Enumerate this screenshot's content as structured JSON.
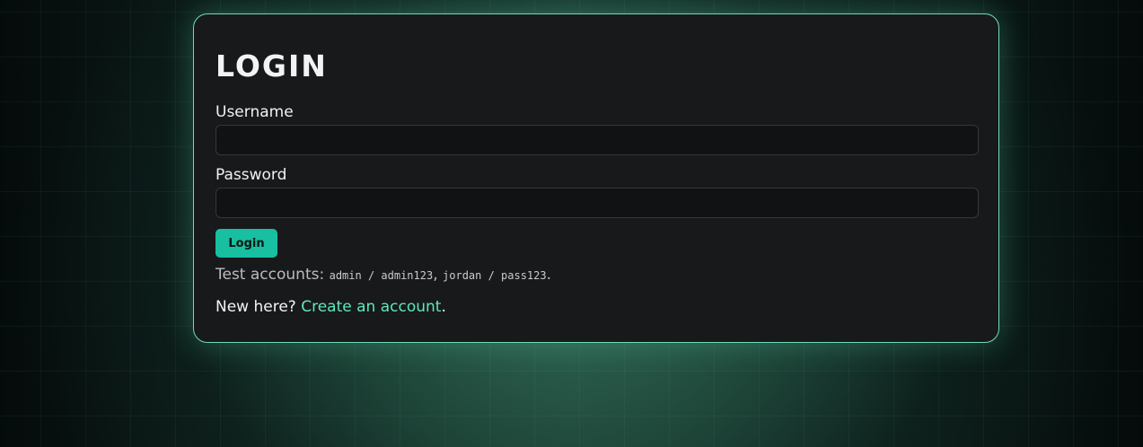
{
  "login": {
    "title": "LOGIN",
    "username_label": "Username",
    "username_value": "",
    "password_label": "Password",
    "password_value": "",
    "submit_label": "Login",
    "test_accounts_prefix": "Test accounts:",
    "account_1": "admin / admin123",
    "separator": ",",
    "account_2": "jordan / pass123",
    "test_accounts_suffix": ".",
    "new_here_text": "New here?",
    "create_account_link": "Create an account",
    "link_suffix": "."
  },
  "colors": {
    "accent": "#18bfa0",
    "link": "#5ee8bd",
    "card_border": "#6fdcb8",
    "card_background": "#17191b"
  }
}
